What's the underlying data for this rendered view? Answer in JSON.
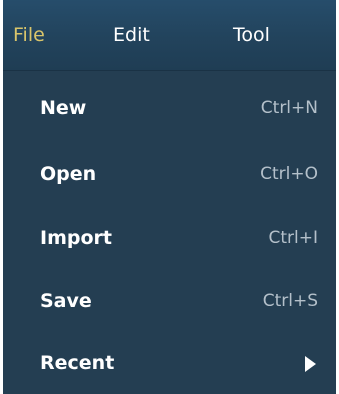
{
  "menubar": {
    "items": [
      {
        "label": "File",
        "active": true
      },
      {
        "label": "Edit",
        "active": false
      },
      {
        "label": "Tool",
        "active": false
      }
    ]
  },
  "file_menu": {
    "items": [
      {
        "label": "New",
        "shortcut": "Ctrl+N"
      },
      {
        "label": "Open",
        "shortcut": "Ctrl+O"
      },
      {
        "label": "Import",
        "shortcut": "Ctrl+I"
      },
      {
        "label": "Save",
        "shortcut": "Ctrl+S"
      },
      {
        "label": "Recent",
        "submenu_icon": "chevron-right-icon"
      }
    ]
  },
  "colors": {
    "menu_background": "#243e52",
    "menubar_background": "#22435c",
    "active_menu_text": "#d9c56b",
    "text": "#ffffff",
    "shortcut_text": "#b4c0ca"
  }
}
